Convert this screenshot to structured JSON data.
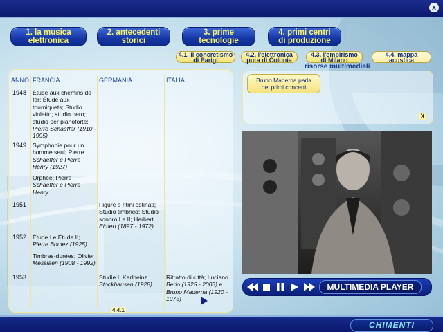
{
  "window": {
    "close_label": "x"
  },
  "tabs": [
    {
      "line1": "1. la musica",
      "line2": "elettronica"
    },
    {
      "line1": "2. antecedenti",
      "line2": "storici"
    },
    {
      "line1": "3. prime",
      "line2": "tecnologie"
    },
    {
      "line1": "4. primi centri",
      "line2": "di produzione"
    }
  ],
  "subtabs": [
    {
      "line1": "4.1. il concretismo",
      "line2": "di Parigi"
    },
    {
      "line1": "4.2. l'elettronica",
      "line2": "pura di Colonia"
    },
    {
      "line1": "4.3. l'empirismo",
      "line2": "di Milano"
    },
    {
      "line1": "4.4. mappa",
      "line2": "acustica"
    }
  ],
  "resources": {
    "title": "risorse multimediali",
    "item_line1": "Bruno Maderna parla",
    "item_line2": "dei primi concerti",
    "close_label": "X"
  },
  "table": {
    "headers": {
      "year": "ANNO",
      "france": "FRANCIA",
      "germany": "GERMANIA",
      "italy": "ITALIA"
    },
    "rows": [
      {
        "year": "1948",
        "france": [
          "Étude aux chemins de",
          "fer; Étude aux",
          "tourniquets; Studio",
          "violetto; studio nero;",
          "studio per pianoforte;",
          "Pierre Schaeffer (1910 -",
          "1995)"
        ]
      },
      {
        "year": "1949",
        "france": [
          "Symphonie pour un",
          "homme seul; Pierre",
          "Schaeffer e Pierre",
          "Henry (1927)"
        ],
        "france2": [
          "Orphée; Pierre",
          "Schaeffer e Pierre",
          "Henry"
        ]
      },
      {
        "year": "1951",
        "germany": [
          "Figure e ritmi ostinati;",
          "Studio timbrico; Studio",
          "sonoro I e II; Herbert",
          "Eimert (1897 - 1972)"
        ]
      },
      {
        "year": "1952",
        "france": [
          "Étude I e Étude II;",
          "Pierre Boulez (1925)"
        ],
        "france2": [
          "Timbres-durées; Olivier",
          "Messiaen (1908 - 1992)"
        ]
      },
      {
        "year": "1953",
        "germany": [
          "Studie I; Karlheinz",
          "Stockhausen (1928)"
        ],
        "italy": [
          "Ritratto di città; Luciano",
          "Berio (1925 - 2003) e",
          "Bruno Maderna (1920 -",
          "1973)"
        ]
      }
    ],
    "page_ref": "4.4.1"
  },
  "player": {
    "label": "MULTIMEDIA PLAYER"
  },
  "brand": {
    "logo": "CHIMENTI"
  },
  "colors": {
    "tab_bg": "#1637a6",
    "tab_text": "#f6f36a",
    "bar_bg": "#0b1a6e",
    "subtab_bg": "#f3e274"
  }
}
